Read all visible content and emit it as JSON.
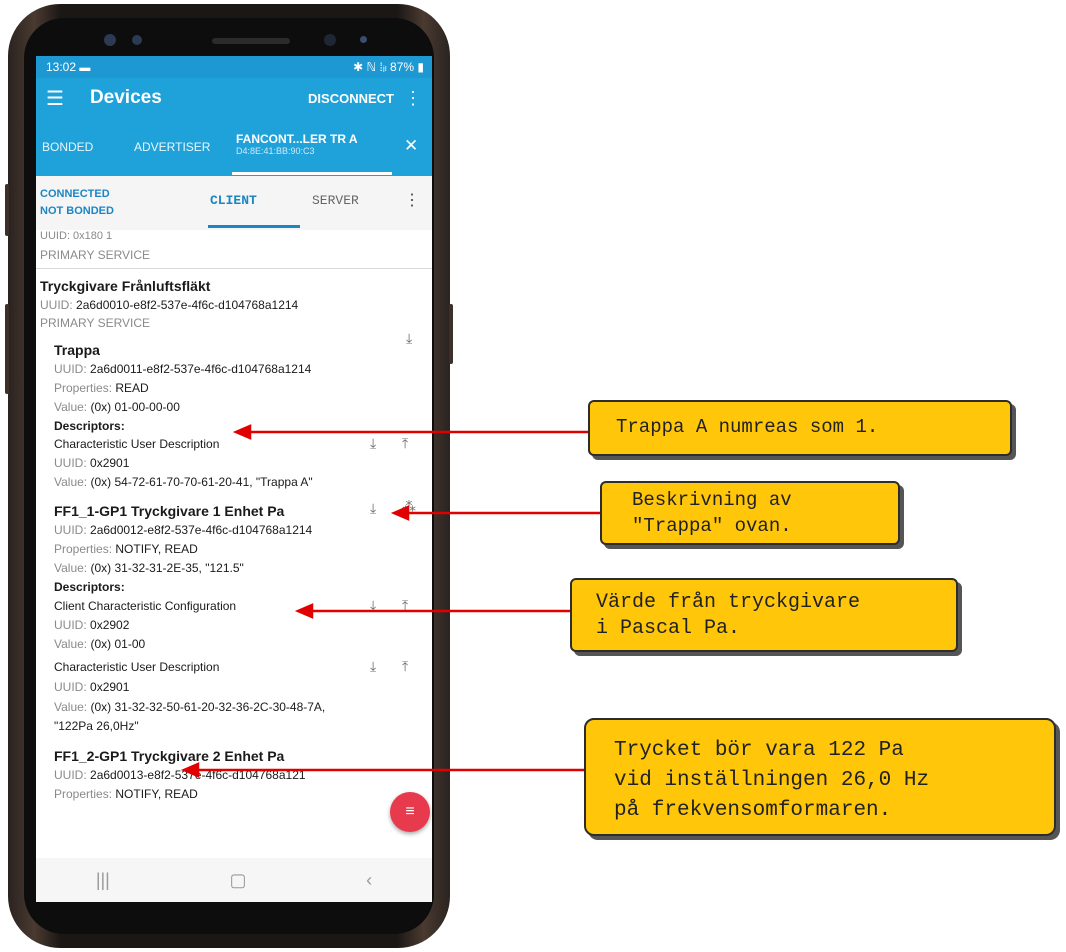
{
  "status_bar": {
    "time": "13:02",
    "right": "✱ ℕ ⁞ᵢₗ 87% ▮"
  },
  "app_bar": {
    "title": "Devices",
    "action": "DISCONNECT"
  },
  "tabs": {
    "bonded": "BONDED",
    "advertiser": "ADVERTISER",
    "active_name": "FANCONT...LER TR A",
    "active_mac": "D4:8E:41:BB:90:C3"
  },
  "subbar": {
    "connected": "CONNECTED",
    "bonded": "NOT BONDED",
    "client": "CLIENT",
    "server": "SERVER"
  },
  "services": {
    "prev_uuid": "UUID: 0x180 1",
    "prev_type": "PRIMARY SERVICE",
    "name": "Tryckgivare Frånluftsfläkt",
    "uuid": "2a6d0010-e8f2-537e-4f6c-d104768a1214",
    "type": "PRIMARY SERVICE"
  },
  "labels": {
    "uuid": "UUID:",
    "properties": "Properties:",
    "value": "Value:",
    "descriptors": "Descriptors:"
  },
  "characteristics": [
    {
      "name": "Trappa",
      "uuid": "2a6d0011-e8f2-537e-4f6c-d104768a1214",
      "properties": "READ",
      "value": "(0x) 01-00-00-00",
      "descriptors": [
        {
          "name": "Characteristic User Description",
          "uuid": "0x2901",
          "value": "(0x) 54-72-61-70-70-61-20-41, \"Trappa A\""
        }
      ]
    },
    {
      "name": "FF1_1-GP1 Tryckgivare 1 Enhet Pa",
      "uuid": "2a6d0012-e8f2-537e-4f6c-d104768a1214",
      "properties": "NOTIFY, READ",
      "value": "(0x) 31-32-31-2E-35, \"121.5\"",
      "descriptors": [
        {
          "name": "Client Characteristic Configuration",
          "uuid": "0x2902",
          "value": "(0x) 01-00"
        },
        {
          "name": "Characteristic User Description",
          "uuid": "0x2901",
          "value": "(0x) 31-32-32-50-61-20-32-36-2C-30-48-7A,",
          "value2": "\"122Pa 26,0Hz\""
        }
      ]
    },
    {
      "name": "FF1_2-GP1 Tryckgivare 2 Enhet Pa",
      "uuid": "2a6d0013-e8f2-537e-4f6c-d104768a121",
      "properties": "NOTIFY, READ"
    }
  ],
  "callouts": [
    {
      "lines": [
        "Trappa A numreas som 1."
      ]
    },
    {
      "lines": [
        "Beskrivning av",
        "\"Trappa\" ovan."
      ]
    },
    {
      "lines": [
        "Värde från tryckgivare",
        "i Pascal Pa."
      ]
    },
    {
      "lines": [
        "Trycket bör vara 122 Pa",
        "vid inställningen 26,0 Hz",
        "på frekvensomformaren."
      ]
    }
  ],
  "colors": {
    "accent": "#1fa2da",
    "callout": "#ffc60a",
    "arrow": "#e00000",
    "fab": "#e73a4d"
  }
}
